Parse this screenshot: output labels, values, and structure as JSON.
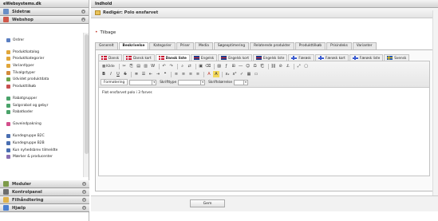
{
  "left": {
    "brand": "eWebsystems.dk",
    "accordion_top": [
      {
        "label": "Sidetræ",
        "icon": "folder-icon",
        "color": "#6a8fc7"
      },
      {
        "label": "Webshop",
        "icon": "cart-icon",
        "color": "#d0584a"
      }
    ],
    "menu": [
      {
        "label": "Ordrer",
        "color": "#5b7fc2"
      },
      {
        "label": "Produktkatalog",
        "color": "#e0a63a"
      },
      {
        "label": "Produktkategorier",
        "color": "#e0a63a"
      },
      {
        "label": "Variantlyper",
        "color": "#e0a63a"
      },
      {
        "label": "Tilvalgstyper",
        "color": "#d38a3a"
      },
      {
        "label": "Udvidet produktdata",
        "color": "#6aa44c"
      },
      {
        "label": "Produkttilkøb",
        "color": "#c85050"
      },
      {
        "label": "Rabatgrupper",
        "color": "#4aa36a"
      },
      {
        "label": "Salgsrabat og gebyr",
        "color": "#4aa36a"
      },
      {
        "label": "Rabatkoder",
        "color": "#4aa36a"
      },
      {
        "label": "Gaveindpakning",
        "color": "#d34f8c"
      },
      {
        "label": "Kundegruppe B2C",
        "color": "#4a6fb2"
      },
      {
        "label": "Kundegruppe B2B",
        "color": "#4a6fb2"
      },
      {
        "label": "Kun nyhedsbrev tilmeldte",
        "color": "#4a6fb2"
      },
      {
        "label": "Mærker & producenter",
        "color": "#8a6fb2"
      }
    ],
    "accordion_bottom": [
      {
        "label": "Moduler",
        "icon": "modules-icon",
        "color": "#7d9a4a"
      },
      {
        "label": "Kontrolpanel",
        "icon": "control-panel-icon",
        "color": "#6d6d6d"
      },
      {
        "label": "Filhåndtering",
        "icon": "files-icon",
        "color": "#e0b24a"
      },
      {
        "label": "Hjælp",
        "icon": "help-icon",
        "color": "#4a7fd0"
      }
    ]
  },
  "right": {
    "header": "Indhold",
    "title": "Redigér: Polo ensfarvet",
    "back": "Tilbage",
    "tabs": [
      "Generelt",
      "Beskrivelse",
      "Kategorier",
      "Priser",
      "Media",
      "Søgeoptimering",
      "Relaterede produkter",
      "Produkttilkøb",
      "Prisindeks",
      "Varianter"
    ],
    "active_tab": 1,
    "lang_tabs": [
      {
        "label": "Dansk",
        "flag": "dk"
      },
      {
        "label": "Dansk kort",
        "flag": "dk"
      },
      {
        "label": "Dansk liste",
        "flag": "dk"
      },
      {
        "label": "Engelsk",
        "flag": "en"
      },
      {
        "label": "Engelsk kort",
        "flag": "en"
      },
      {
        "label": "Engelsk liste",
        "flag": "en"
      },
      {
        "label": "Færøsk",
        "flag": "fo"
      },
      {
        "label": "Færøsk kort",
        "flag": "fo"
      },
      {
        "label": "Færøsk liste",
        "flag": "fo"
      },
      {
        "label": "Svensk",
        "flag": "se"
      }
    ],
    "active_lang": 2,
    "toolbar": {
      "source_label": "Kilde",
      "format_label": "Formatering",
      "font_label": "Skrifttype",
      "size_label": "Skriftstørrelse"
    },
    "content_text": "Flot ensfarvet polo i 3 farver.",
    "save_label": "Gem"
  }
}
